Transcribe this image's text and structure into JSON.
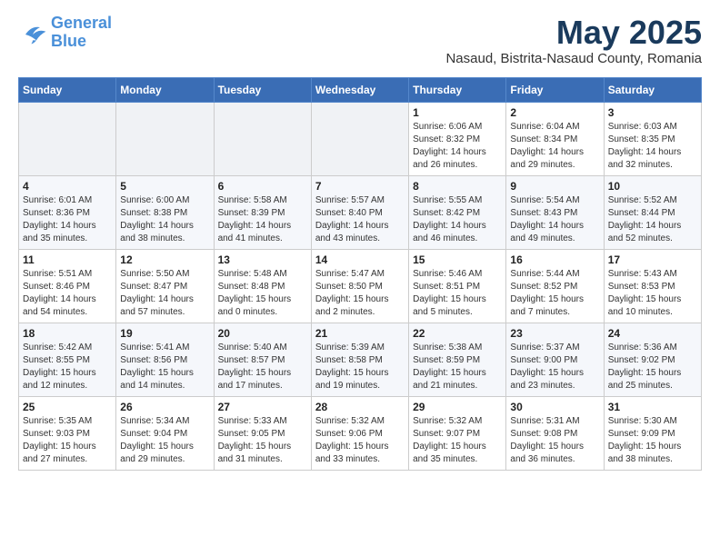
{
  "logo": {
    "line1": "General",
    "line2": "Blue"
  },
  "title": "May 2025",
  "subtitle": "Nasaud, Bistrita-Nasaud County, Romania",
  "headers": [
    "Sunday",
    "Monday",
    "Tuesday",
    "Wednesday",
    "Thursday",
    "Friday",
    "Saturday"
  ],
  "weeks": [
    [
      {
        "day": "",
        "info": ""
      },
      {
        "day": "",
        "info": ""
      },
      {
        "day": "",
        "info": ""
      },
      {
        "day": "",
        "info": ""
      },
      {
        "day": "1",
        "info": "Sunrise: 6:06 AM\nSunset: 8:32 PM\nDaylight: 14 hours\nand 26 minutes."
      },
      {
        "day": "2",
        "info": "Sunrise: 6:04 AM\nSunset: 8:34 PM\nDaylight: 14 hours\nand 29 minutes."
      },
      {
        "day": "3",
        "info": "Sunrise: 6:03 AM\nSunset: 8:35 PM\nDaylight: 14 hours\nand 32 minutes."
      }
    ],
    [
      {
        "day": "4",
        "info": "Sunrise: 6:01 AM\nSunset: 8:36 PM\nDaylight: 14 hours\nand 35 minutes."
      },
      {
        "day": "5",
        "info": "Sunrise: 6:00 AM\nSunset: 8:38 PM\nDaylight: 14 hours\nand 38 minutes."
      },
      {
        "day": "6",
        "info": "Sunrise: 5:58 AM\nSunset: 8:39 PM\nDaylight: 14 hours\nand 41 minutes."
      },
      {
        "day": "7",
        "info": "Sunrise: 5:57 AM\nSunset: 8:40 PM\nDaylight: 14 hours\nand 43 minutes."
      },
      {
        "day": "8",
        "info": "Sunrise: 5:55 AM\nSunset: 8:42 PM\nDaylight: 14 hours\nand 46 minutes."
      },
      {
        "day": "9",
        "info": "Sunrise: 5:54 AM\nSunset: 8:43 PM\nDaylight: 14 hours\nand 49 minutes."
      },
      {
        "day": "10",
        "info": "Sunrise: 5:52 AM\nSunset: 8:44 PM\nDaylight: 14 hours\nand 52 minutes."
      }
    ],
    [
      {
        "day": "11",
        "info": "Sunrise: 5:51 AM\nSunset: 8:46 PM\nDaylight: 14 hours\nand 54 minutes."
      },
      {
        "day": "12",
        "info": "Sunrise: 5:50 AM\nSunset: 8:47 PM\nDaylight: 14 hours\nand 57 minutes."
      },
      {
        "day": "13",
        "info": "Sunrise: 5:48 AM\nSunset: 8:48 PM\nDaylight: 15 hours\nand 0 minutes."
      },
      {
        "day": "14",
        "info": "Sunrise: 5:47 AM\nSunset: 8:50 PM\nDaylight: 15 hours\nand 2 minutes."
      },
      {
        "day": "15",
        "info": "Sunrise: 5:46 AM\nSunset: 8:51 PM\nDaylight: 15 hours\nand 5 minutes."
      },
      {
        "day": "16",
        "info": "Sunrise: 5:44 AM\nSunset: 8:52 PM\nDaylight: 15 hours\nand 7 minutes."
      },
      {
        "day": "17",
        "info": "Sunrise: 5:43 AM\nSunset: 8:53 PM\nDaylight: 15 hours\nand 10 minutes."
      }
    ],
    [
      {
        "day": "18",
        "info": "Sunrise: 5:42 AM\nSunset: 8:55 PM\nDaylight: 15 hours\nand 12 minutes."
      },
      {
        "day": "19",
        "info": "Sunrise: 5:41 AM\nSunset: 8:56 PM\nDaylight: 15 hours\nand 14 minutes."
      },
      {
        "day": "20",
        "info": "Sunrise: 5:40 AM\nSunset: 8:57 PM\nDaylight: 15 hours\nand 17 minutes."
      },
      {
        "day": "21",
        "info": "Sunrise: 5:39 AM\nSunset: 8:58 PM\nDaylight: 15 hours\nand 19 minutes."
      },
      {
        "day": "22",
        "info": "Sunrise: 5:38 AM\nSunset: 8:59 PM\nDaylight: 15 hours\nand 21 minutes."
      },
      {
        "day": "23",
        "info": "Sunrise: 5:37 AM\nSunset: 9:00 PM\nDaylight: 15 hours\nand 23 minutes."
      },
      {
        "day": "24",
        "info": "Sunrise: 5:36 AM\nSunset: 9:02 PM\nDaylight: 15 hours\nand 25 minutes."
      }
    ],
    [
      {
        "day": "25",
        "info": "Sunrise: 5:35 AM\nSunset: 9:03 PM\nDaylight: 15 hours\nand 27 minutes."
      },
      {
        "day": "26",
        "info": "Sunrise: 5:34 AM\nSunset: 9:04 PM\nDaylight: 15 hours\nand 29 minutes."
      },
      {
        "day": "27",
        "info": "Sunrise: 5:33 AM\nSunset: 9:05 PM\nDaylight: 15 hours\nand 31 minutes."
      },
      {
        "day": "28",
        "info": "Sunrise: 5:32 AM\nSunset: 9:06 PM\nDaylight: 15 hours\nand 33 minutes."
      },
      {
        "day": "29",
        "info": "Sunrise: 5:32 AM\nSunset: 9:07 PM\nDaylight: 15 hours\nand 35 minutes."
      },
      {
        "day": "30",
        "info": "Sunrise: 5:31 AM\nSunset: 9:08 PM\nDaylight: 15 hours\nand 36 minutes."
      },
      {
        "day": "31",
        "info": "Sunrise: 5:30 AM\nSunset: 9:09 PM\nDaylight: 15 hours\nand 38 minutes."
      }
    ]
  ]
}
